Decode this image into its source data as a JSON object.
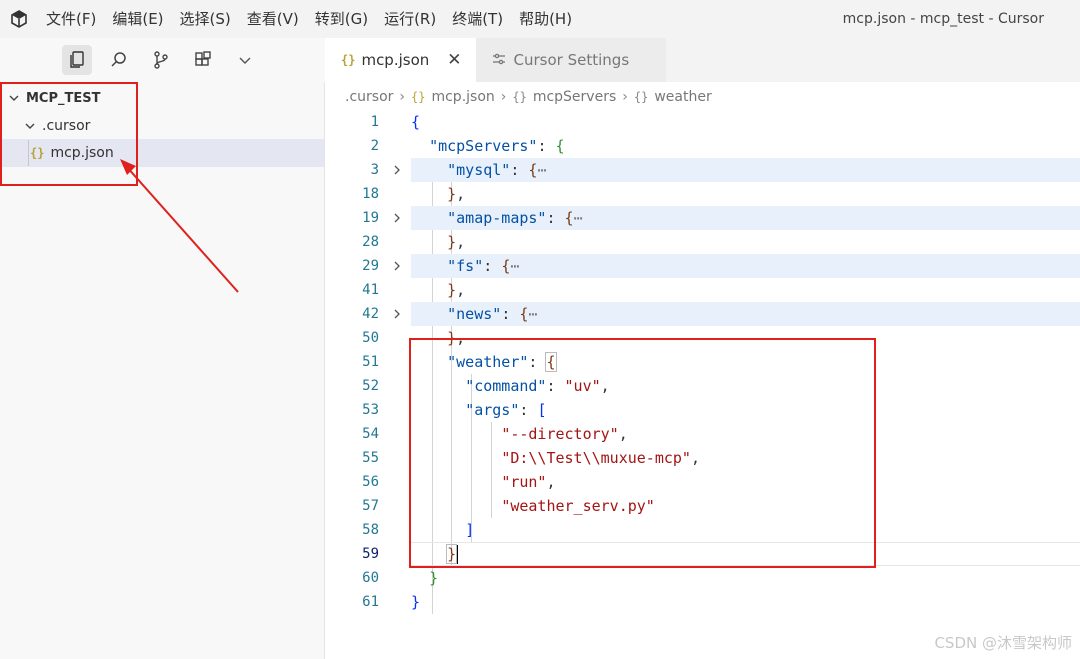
{
  "titlebar": {
    "menus": [
      "文件(F)",
      "编辑(E)",
      "选择(S)",
      "查看(V)",
      "转到(G)",
      "运行(R)",
      "终端(T)",
      "帮助(H)"
    ],
    "window_title": "mcp.json - mcp_test - Cursor"
  },
  "sidebar": {
    "root_folder": "MCP_TEST",
    "subfolder": ".cursor",
    "file": "mcp.json",
    "toolbar_icons": [
      "files-icon",
      "search-icon",
      "source-control-icon",
      "extensions-icon",
      "chevron-down-icon"
    ]
  },
  "tabs": [
    {
      "label": "mcp.json",
      "active": true
    },
    {
      "label": "Cursor Settings",
      "active": false
    }
  ],
  "breadcrumb": {
    "folder": ".cursor",
    "file": "mcp.json",
    "symbol1": "mcpServers",
    "symbol2": "weather"
  },
  "editor": {
    "lines": [
      {
        "num": "1"
      },
      {
        "num": "2"
      },
      {
        "num": "3"
      },
      {
        "num": "18"
      },
      {
        "num": "19"
      },
      {
        "num": "28"
      },
      {
        "num": "29"
      },
      {
        "num": "41"
      },
      {
        "num": "42"
      },
      {
        "num": "50"
      },
      {
        "num": "51"
      },
      {
        "num": "52"
      },
      {
        "num": "53"
      },
      {
        "num": "54"
      },
      {
        "num": "55"
      },
      {
        "num": "56"
      },
      {
        "num": "57"
      },
      {
        "num": "58"
      },
      {
        "num": "59"
      },
      {
        "num": "60"
      },
      {
        "num": "61"
      }
    ],
    "keys": {
      "mcpServers": "\"mcpServers\"",
      "mysql": "\"mysql\"",
      "amap": "\"amap-maps\"",
      "fs": "\"fs\"",
      "news": "\"news\"",
      "weather": "\"weather\"",
      "command": "\"command\"",
      "args": "\"args\""
    },
    "values": {
      "command": "\"uv\"",
      "arg1": "\"--directory\"",
      "arg2": "\"D:\\\\Test\\\\muxue-mcp\"",
      "arg3": "\"run\"",
      "arg4": "\"weather_serv.py\""
    },
    "ellipsis": "⋯"
  },
  "watermark": "CSDN @沐雪架构师",
  "colors": {
    "annotation": "#e0201c",
    "key": "#0451a5",
    "string": "#a31515",
    "line_number": "#237893"
  }
}
